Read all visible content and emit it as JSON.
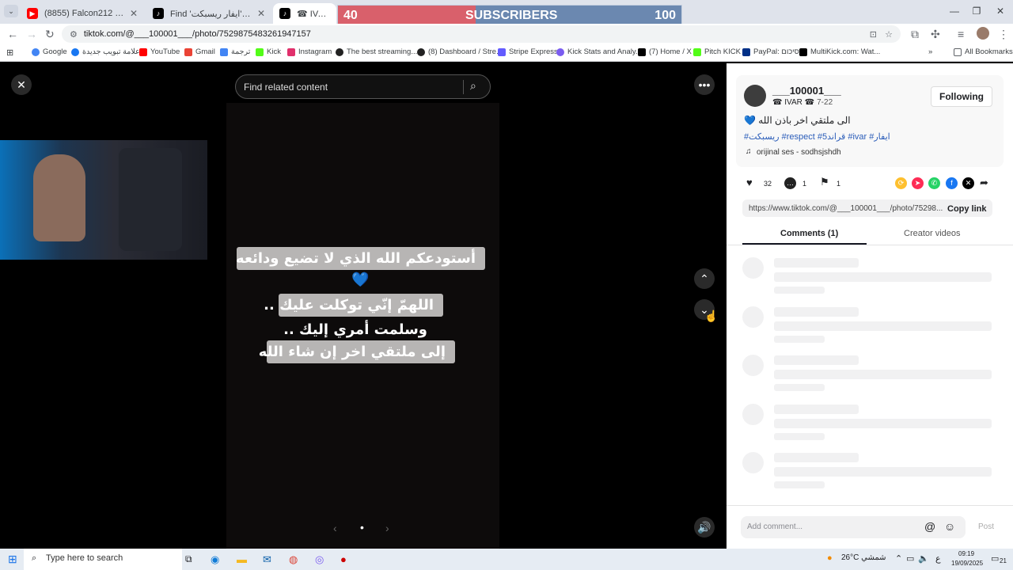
{
  "browser": {
    "tabs": [
      {
        "label": "(8855) Falcon212 - YouTube",
        "color": "#ff0000"
      },
      {
        "label": "Find 'ايفار ريسبكت' on TikTok | T",
        "color": "#000000"
      },
      {
        "label": "☎ IVAR ☎ (@___100001___)",
        "color": "#000000"
      }
    ],
    "url": "tiktok.com/@___100001___/photo/7529875483261947157",
    "bookmarks": [
      {
        "label": "Google",
        "color": "#4285f4"
      },
      {
        "label": "علامة تبويب جديدة",
        "color": "#1877f2"
      },
      {
        "label": "YouTube",
        "color": "#ff0000"
      },
      {
        "label": "Gmail",
        "color": "#ea4335"
      },
      {
        "label": "ترجمة",
        "color": "#4285f4"
      },
      {
        "label": "Kick",
        "color": "#53fc18"
      },
      {
        "label": "Instagram",
        "color": "#e1306c"
      },
      {
        "label": "The best streaming...",
        "color": "#222222"
      },
      {
        "label": "(8) Dashboard / Stre...",
        "color": "#222222"
      },
      {
        "label": "Stripe Express",
        "color": "#635bff"
      },
      {
        "label": "Kick Stats and Analy...",
        "color": "#7a5cf0"
      },
      {
        "label": "(7) Home / X",
        "color": "#000000"
      },
      {
        "label": "Pitch KICK",
        "color": "#53fc18"
      },
      {
        "label": "PayPal: סיכום",
        "color": "#003087"
      },
      {
        "label": "MultiKick.com: Wat...",
        "color": "#000000"
      }
    ],
    "all_bookmarks": "All Bookmarks"
  },
  "overlay": {
    "left": "40",
    "title": "SUBSCRIBERS",
    "right": "100",
    "progress": 0.4
  },
  "viewer": {
    "search_placeholder": "Find related content",
    "caption": [
      "أستودعكم الله الذي لا تضيع ودائعه",
      "💙",
      "اللهمّ إنّي توكلت عليك ..",
      "وسلمت أمري إليك ..",
      "إلى ملتقي اخر إن شاء الله"
    ],
    "page_dot": "•"
  },
  "post": {
    "username": "___100001___",
    "display_name": "☎ IVAR ☎",
    "date": "7-22",
    "follow_label": "Following",
    "caption": "الى ملتقي اخر باذن الله 💙",
    "hashtags": "#ريسبكت #respect #قراند5 #ivar #ايفار",
    "sound": "orijinal ses - sodhsjshdh",
    "likes": "32",
    "comments": "1",
    "saves": "1",
    "share_icons": [
      {
        "name": "embed-icon",
        "color": "#fec02f"
      },
      {
        "name": "send-icon",
        "color": "#fe2c55"
      },
      {
        "name": "whatsapp-icon",
        "color": "#25d366"
      },
      {
        "name": "facebook-icon",
        "color": "#1877f2"
      },
      {
        "name": "x-icon",
        "color": "#000000"
      }
    ],
    "link": "https://www.tiktok.com/@___100001___/photo/75298...",
    "copy_label": "Copy link",
    "tab_comments": "Comments (1)",
    "tab_creator": "Creator videos",
    "add_comment_placeholder": "Add comment...",
    "post_label": "Post"
  },
  "taskbar": {
    "search_placeholder": "Type here to search",
    "weather": "26°C شمشي",
    "lang": "ع",
    "time": "09:19",
    "date": "19/09/2025",
    "notif_count": "21"
  }
}
